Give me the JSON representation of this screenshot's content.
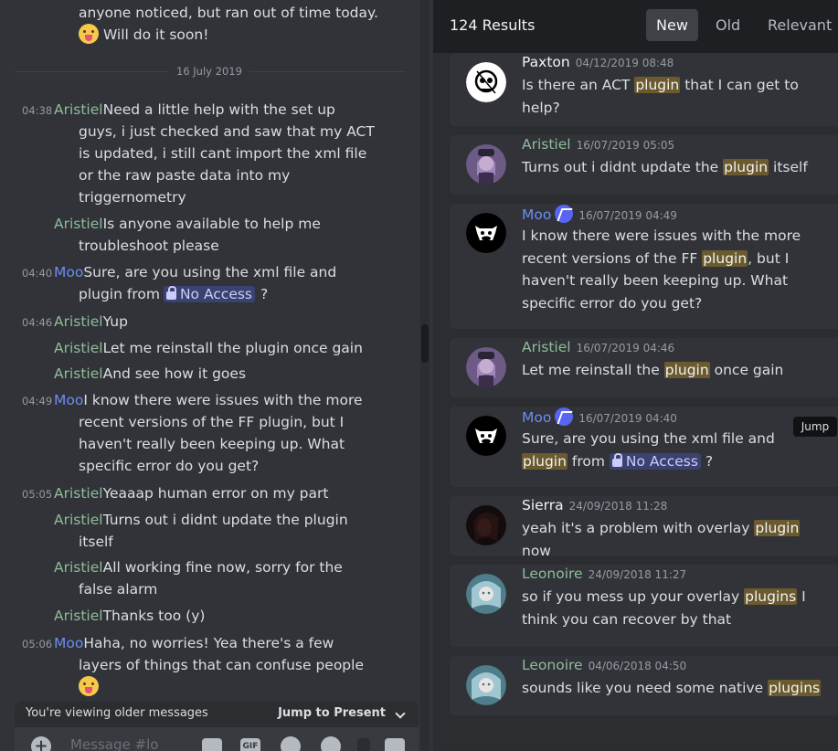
{
  "chat": {
    "top_lines": [
      "anyone noticed, but ran out of time today.",
      "Will do it soon!"
    ],
    "date_divider": "16 July 2019",
    "mention_text": "No Access",
    "messages": [
      {
        "ts": "04:38",
        "author": "Aristiel",
        "lines": [
          "Need a little help with the set up",
          "guys, i just checked and saw that my ACT",
          "is updated, i still cant import the xml file",
          "or the raw paste data into my",
          "triggernometry"
        ]
      },
      {
        "ts": "",
        "author": "Aristiel",
        "lines": [
          "Is anyone available to help me",
          "troubleshoot please"
        ]
      },
      {
        "ts": "04:40",
        "author": "Moo",
        "lines": [
          "Sure, are you using the xml file and",
          "plugin from"
        ],
        "trail": "?"
      },
      {
        "ts": "04:46",
        "author": "Aristiel",
        "lines": [
          "Yup"
        ]
      },
      {
        "ts": "",
        "author": "Aristiel",
        "lines": [
          "Let me reinstall the plugin once gain"
        ]
      },
      {
        "ts": "",
        "author": "Aristiel",
        "lines": [
          "And see how it goes"
        ]
      },
      {
        "ts": "04:49",
        "author": "Moo",
        "lines": [
          "I know there were issues with the more",
          "recent versions of the FF plugin, but I",
          "haven't really been keeping up.  What",
          "specific error do you get?"
        ]
      },
      {
        "ts": "05:05",
        "author": "Aristiel",
        "lines": [
          "Yeaaap human error on my part"
        ]
      },
      {
        "ts": "",
        "author": "Aristiel",
        "lines": [
          "Turns out i didnt update the plugin",
          "itself"
        ]
      },
      {
        "ts": "",
        "author": "Aristiel",
        "lines": [
          "All working fine now, sorry for the",
          "false alarm"
        ]
      },
      {
        "ts": "",
        "author": "Aristiel",
        "lines": [
          "Thanks too (y)"
        ]
      },
      {
        "ts": "05:06",
        "author": "Moo",
        "lines": [
          "Haha, no worries!  Yea there's a few",
          "layers of things that can confuse people"
        ]
      }
    ],
    "older_bar": {
      "label": "You're viewing older messages",
      "jump": "Jump to Present"
    },
    "composer_placeholder": "Message #lo",
    "composer_gif": "GIF"
  },
  "search": {
    "results_count": "124 Results",
    "sort": [
      {
        "label": "New",
        "active": true
      },
      {
        "label": "Old",
        "active": false
      },
      {
        "label": "Relevant",
        "active": false
      }
    ],
    "jump_tooltip": "Jump",
    "results": [
      {
        "author": "Paxton",
        "date": "04/12/2019 08:48",
        "color": "#f2f3f5",
        "avatar": "skull",
        "segments": [
          [
            "Is there an ACT ",
            ""
          ],
          [
            "plugin",
            "hl"
          ],
          [
            " that I can get to help?",
            ""
          ]
        ]
      },
      {
        "author": "Aristiel",
        "date": "16/07/2019 05:05",
        "color": "#8fbd9a",
        "avatar": "girl",
        "segments": [
          [
            "Turns out i didnt update the ",
            ""
          ],
          [
            "plugin",
            "hl"
          ],
          [
            " itself",
            ""
          ]
        ]
      },
      {
        "author": "Moo",
        "date": "16/07/2019 04:49",
        "color": "#6b8ef0",
        "avatar": "cow",
        "badge": true,
        "segments": [
          [
            "I know there were issues with the more recent versions of the FF ",
            ""
          ],
          [
            "plugin",
            "hl"
          ],
          [
            ", but I haven't really been keeping up.  What specific error do you get?",
            ""
          ]
        ]
      },
      {
        "author": "Aristiel",
        "date": "16/07/2019 04:46",
        "color": "#8fbd9a",
        "avatar": "girl",
        "segments": [
          [
            "Let me reinstall the ",
            ""
          ],
          [
            "plugin",
            "hl"
          ],
          [
            " once gain",
            ""
          ]
        ]
      },
      {
        "author": "Moo",
        "date": "16/07/2019 04:40",
        "color": "#6b8ef0",
        "avatar": "cow",
        "badge": true,
        "segments": [
          [
            "Sure, are you using the xml file and ",
            ""
          ],
          [
            "plugin",
            "hl"
          ],
          [
            " from ",
            ""
          ],
          [
            "No Access",
            "mention"
          ],
          [
            " ?",
            ""
          ]
        ]
      },
      {
        "author": "Sierra",
        "date": "24/09/2018 11:28",
        "color": "#f2f3f5",
        "avatar": "dark",
        "segments": [
          [
            "yeah it's a problem with overlay ",
            ""
          ],
          [
            "plugin",
            "hl"
          ],
          [
            " now",
            ""
          ]
        ]
      },
      {
        "author": "Leonoire",
        "date": "24/09/2018 11:27",
        "color": "#8fbd9a",
        "avatar": "teal",
        "segments": [
          [
            "so if you mess up your overlay ",
            ""
          ],
          [
            "plugins",
            "hl"
          ],
          [
            " I think you can recover by that",
            ""
          ]
        ]
      },
      {
        "author": "Leonoire",
        "date": "04/06/2018 04:50",
        "color": "#8fbd9a",
        "avatar": "teal",
        "segments": [
          [
            "sounds like you need some native ",
            ""
          ],
          [
            "plugins",
            "hl"
          ]
        ]
      }
    ]
  }
}
